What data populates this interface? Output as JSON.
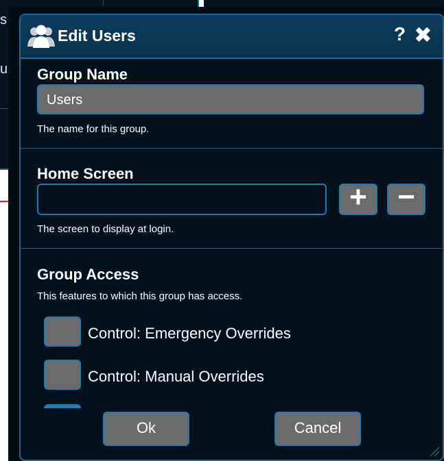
{
  "background_window": {
    "fragments": [
      "s",
      "u"
    ]
  },
  "dialog": {
    "title": "Edit Users",
    "title_icon": "users-group-icon",
    "help_label": "?",
    "close_label": "✖"
  },
  "group_name": {
    "label": "Group Name",
    "value": "Users",
    "help": "The name for this group."
  },
  "home_screen": {
    "label": "Home Screen",
    "value": "",
    "help": "The screen to display at login.",
    "add_label": "+",
    "remove_label": "−"
  },
  "group_access": {
    "label": "Group Access",
    "help": "This features to which this group has access.",
    "options": [
      {
        "label": "Control: Emergency Overrides",
        "checked": false
      },
      {
        "label": "Control: Manual Overrides",
        "checked": false
      }
    ]
  },
  "buttons": {
    "ok": "Ok",
    "cancel": "Cancel"
  },
  "colors": {
    "accent": "#1f7db5",
    "background": "#03111c",
    "control_fill": "#6b6b6b",
    "arrow": "#e0201c"
  }
}
